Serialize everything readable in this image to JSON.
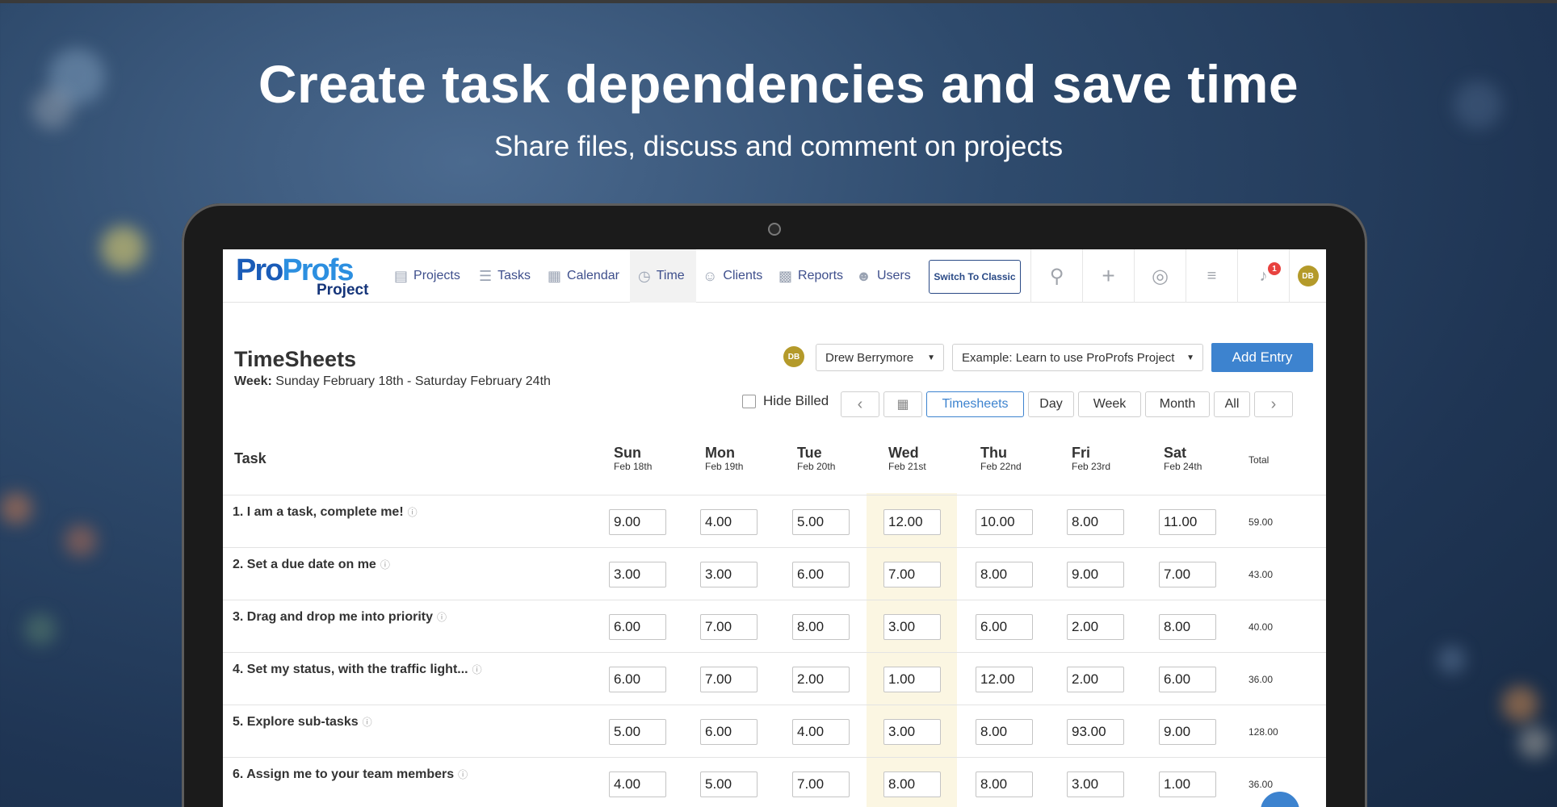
{
  "hero": {
    "title": "Create task dependencies and save time",
    "subtitle": "Share files, discuss and comment on projects"
  },
  "logo": {
    "main_a": "Pro",
    "main_b": "Profs",
    "sub": "Project"
  },
  "nav": {
    "items": [
      {
        "label": "Projects",
        "icon": "presentation-icon"
      },
      {
        "label": "Tasks",
        "icon": "list-icon"
      },
      {
        "label": "Calendar",
        "icon": "calendar-icon"
      },
      {
        "label": "Time",
        "icon": "clock-icon",
        "active": true
      },
      {
        "label": "Clients",
        "icon": "user-icon"
      },
      {
        "label": "Reports",
        "icon": "bar-chart-icon"
      },
      {
        "label": "Users",
        "icon": "person-icon"
      }
    ],
    "switch_label": "Switch To Classic",
    "notification_count": "1",
    "avatar_initials": "DB"
  },
  "page": {
    "title": "TimeSheets",
    "week_prefix": "Week:",
    "week_range": " Sunday February 18th - Saturday February 24th",
    "user_avatar": "DB",
    "user_select": "Drew Berrymore",
    "project_select": "Example: Learn to use ProProfs Project",
    "add_entry": "Add Entry",
    "hide_billed": "Hide Billed",
    "views": [
      "Timesheets",
      "Day",
      "Week",
      "Month",
      "All"
    ],
    "active_view": "Timesheets"
  },
  "table": {
    "task_header": "Task",
    "total_header": "Total",
    "days": [
      {
        "name": "Sun",
        "date": "Feb 18th"
      },
      {
        "name": "Mon",
        "date": "Feb 19th"
      },
      {
        "name": "Tue",
        "date": "Feb 20th"
      },
      {
        "name": "Wed",
        "date": "Feb 21st"
      },
      {
        "name": "Thu",
        "date": "Feb 22nd"
      },
      {
        "name": "Fri",
        "date": "Feb 23rd"
      },
      {
        "name": "Sat",
        "date": "Feb 24th"
      }
    ],
    "highlight_day": "Wed",
    "rows": [
      {
        "task": "1. I am a task, complete me!",
        "hours": [
          "9.00",
          "4.00",
          "5.00",
          "12.00",
          "10.00",
          "8.00",
          "11.00"
        ],
        "total": "59.00"
      },
      {
        "task": "2. Set a due date on me",
        "hours": [
          "3.00",
          "3.00",
          "6.00",
          "7.00",
          "8.00",
          "9.00",
          "7.00"
        ],
        "total": "43.00"
      },
      {
        "task": "3. Drag and drop me into priority",
        "hours": [
          "6.00",
          "7.00",
          "8.00",
          "3.00",
          "6.00",
          "2.00",
          "8.00"
        ],
        "total": "40.00"
      },
      {
        "task": "4. Set my status, with the traffic light...",
        "hours": [
          "6.00",
          "7.00",
          "2.00",
          "1.00",
          "12.00",
          "2.00",
          "6.00"
        ],
        "total": "36.00"
      },
      {
        "task": "5. Explore sub-tasks",
        "hours": [
          "5.00",
          "6.00",
          "4.00",
          "3.00",
          "8.00",
          "93.00",
          "9.00"
        ],
        "total": "128.00"
      },
      {
        "task": "6. Assign me to your team members",
        "hours": [
          "4.00",
          "5.00",
          "7.00",
          "8.00",
          "8.00",
          "3.00",
          "1.00"
        ],
        "total": "36.00"
      }
    ]
  }
}
